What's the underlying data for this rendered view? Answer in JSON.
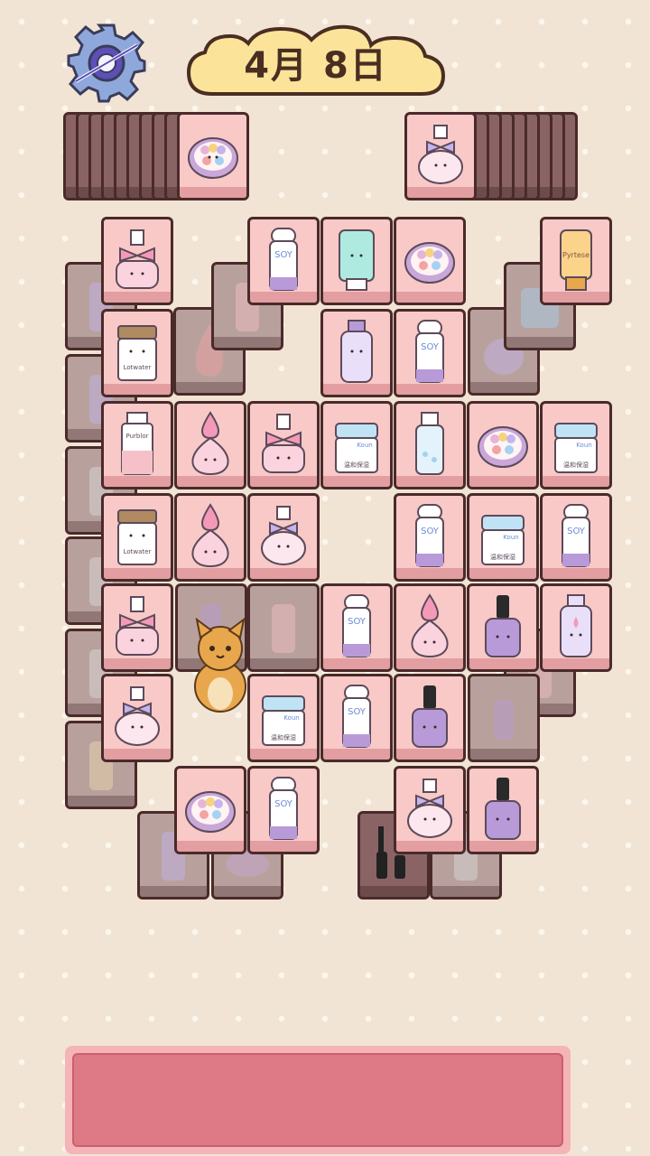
{
  "header": {
    "date_label": "4月  8日",
    "settings_icon": "gear-icon"
  },
  "colors": {
    "background": "#f1e4d4",
    "tile_face": "#f8c9c7",
    "tile_edge": "#4a2a2a",
    "tray": "#dd7a86",
    "banner": "#fbe49a"
  },
  "item_labels": {
    "soy_bottle": "SOY",
    "cream_jar": "Koun",
    "cream_jar_sub": "温和保湿",
    "face_cream": "Lotwater",
    "toner": "Purblor",
    "sunscreen": "Pyrtese"
  },
  "stacks": {
    "left_deck_top": "eyeshadow-palette",
    "right_deck_top": "perfume-bow-lilac"
  },
  "board": {
    "row_1": [
      "perfume-bow-pink",
      "soy-bottle",
      "tube-mint",
      "eyeshadow-palette",
      "sunscreen-tube"
    ],
    "row_2": [
      "face-cream-jar",
      "lotion-bottle-lilac",
      "soy-bottle"
    ],
    "row_3": [
      "toner-bottle",
      "perfume-drop",
      "perfume-bow-pink",
      "cream-jar-koun",
      "spray-bottle",
      "eyeshadow-palette",
      "cream-jar-koun"
    ],
    "row_4": [
      "face-cream-jar",
      "perfume-drop",
      "perfume-bow-lilac",
      "soy-bottle",
      "cream-jar-koun",
      "soy-bottle"
    ],
    "row_5": [
      "perfume-bow-pink",
      "soy-bottle",
      "perfume-drop",
      "nail-polish",
      "lotion-bottle-lilac"
    ],
    "row_6": [
      "perfume-bow-lilac",
      "cream-jar-koun",
      "soy-bottle",
      "nail-polish"
    ],
    "row_7": [
      "eyeshadow-palette",
      "soy-bottle",
      "perfume-bow-lilac",
      "nail-polish"
    ]
  },
  "tray": {
    "slots_filled": 0
  }
}
